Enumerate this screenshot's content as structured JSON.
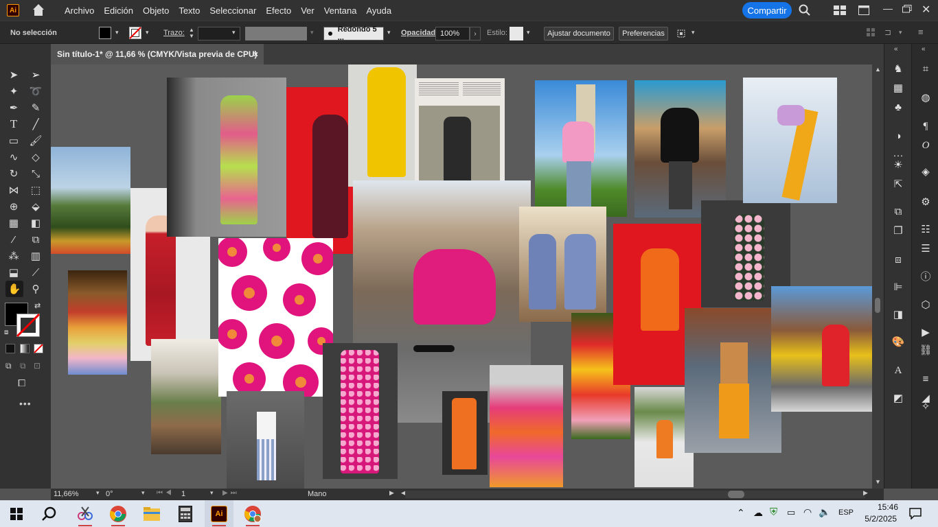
{
  "app": {
    "logo": "Ai",
    "menu": [
      "Archivo",
      "Edición",
      "Objeto",
      "Texto",
      "Seleccionar",
      "Efecto",
      "Ver",
      "Ventana",
      "Ayuda"
    ],
    "share_label": "Compartir"
  },
  "control_bar": {
    "selection_status": "No selección",
    "stroke_label": "Trazo:",
    "brush_value": "Redondo 5 ...",
    "opacity_label": "Opacidad:",
    "opacity_value": "100%",
    "style_label": "Estilo:",
    "adjust_document_label": "Ajustar documento",
    "preferences_label": "Preferencias"
  },
  "document_tab": {
    "title": "Sin título-1* @ 11,66 % (CMYK/Vista previa de CPU)",
    "close": "×"
  },
  "status_bar": {
    "zoom": "11,66%",
    "rotation": "0°",
    "artboard": "1",
    "tool": "Mano"
  },
  "taskbar": {
    "time": "15:46",
    "date": "5/2/2025",
    "language": "ESP",
    "apps": [
      "windows-start",
      "search",
      "snipping-tool",
      "chrome",
      "file-explorer",
      "calculator",
      "illustrator",
      "chrome-profile"
    ]
  },
  "colors": {
    "accent": "#1473e6",
    "ai_orange": "#ff9a00"
  }
}
